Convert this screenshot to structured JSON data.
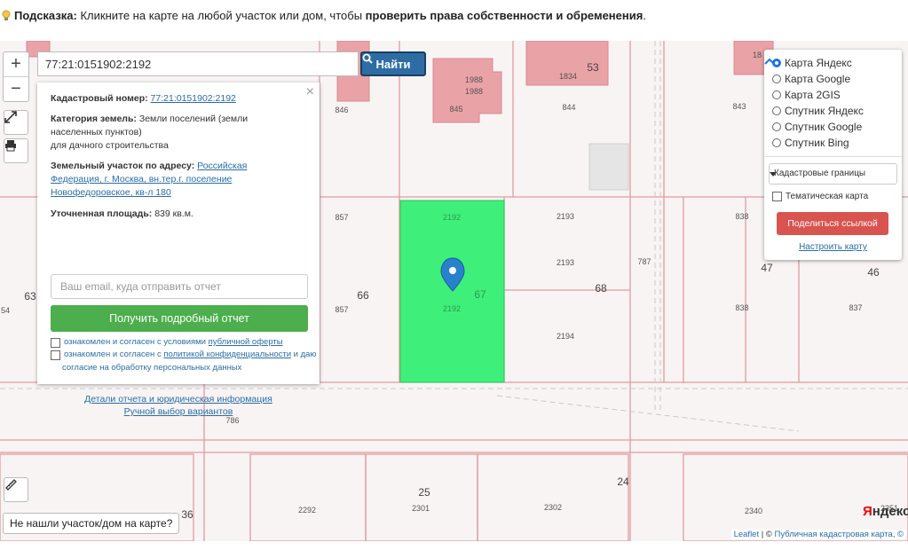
{
  "hint": {
    "label": "Подсказка:",
    "text": " Кликните на карте на любой участок или дом, чтобы ",
    "bold": "проверить права собственности и обременения",
    "end": "."
  },
  "search": {
    "value": "77:21:0151902:2192",
    "button_label": "Найти"
  },
  "zoom": {
    "in": "+",
    "out": "−"
  },
  "info": {
    "cad_label": "Кадастровый номер:",
    "cad_value": "77:21:0151902:2192",
    "cat_label": "Категория земель:",
    "cat_line1": "Земли поселений (земли",
    "cat_line2": "населенных пунктов)",
    "cat_line3": "для дачного строительства",
    "addr_label": "Земельный участок по адресу:",
    "addr_line1": "Российская",
    "addr_line2": "Федерация, г. Москва, вн.тер.г. поселение",
    "addr_line3": "Новофедоровское, кв-л 180",
    "area_label": "Уточненная площадь:",
    "area_value": "839 кв.м.",
    "email_placeholder": "Ваш email, куда отправить отчет",
    "report_button": "Получить подробный отчет",
    "agree1_prefix": "ознакомлен и согласен с условиями ",
    "agree1_link": "публичной оферты",
    "agree2_prefix": "ознакомлен и согласен с ",
    "agree2_link": "политикой конфиденциальности",
    "agree2_mid": " и даю",
    "agree2_line2": "согласие на обработку персональных данных",
    "details_link": "Детали отчета и юридическая информация",
    "manual_link": "Ручной выбор вариантов",
    "close": "×"
  },
  "layers": {
    "options": [
      "Карта Яндекс",
      "Карта Google",
      "Карта 2GIS",
      "Спутник Яндекс",
      "Спутник Google",
      "Спутник Bing"
    ],
    "selected": "Карта Яндекс",
    "overlay_select": "Кадастровые границы",
    "thematic": "Тематическая карта",
    "share_button": "Поделиться ссылкой",
    "configure_link": "Настроить карту"
  },
  "not_found": "Не нашли участок/дом на карте?",
  "attribution": {
    "leaflet": "Leaflet",
    "sep": " | © ",
    "source": "Публичная кадастровая карта, ©"
  },
  "yandex_logo": {
    "y": "Я",
    "rest": "ндекс"
  },
  "map_labels": {
    "b1988a": "1988",
    "b1988b": "1988",
    "b1834": "1834",
    "b53": "53",
    "b845": "845",
    "b844": "844",
    "b846": "846",
    "b843": "843",
    "b18": "18",
    "p857a": "857",
    "p857b": "857",
    "p66": "66",
    "p2192a": "2192",
    "p2192b": "2192",
    "p67": "67",
    "p2193a": "2193",
    "p2193b": "2193",
    "p68": "68",
    "p2194": "2194",
    "p787": "787",
    "p838a": "838",
    "p838b": "838",
    "p47": "47",
    "p46": "46",
    "p837": "837",
    "p63": "63",
    "p54": "54",
    "p786": "786",
    "p25": "25",
    "p2292": "2292",
    "p2301": "2301",
    "p2302": "2302",
    "p24": "24",
    "p2340": "2340",
    "p2351": "2351",
    "p36": "36"
  },
  "colors": {
    "selected_parcel": "#3ef07a",
    "building": "#e9a2a6",
    "boundary": "#e29aa0",
    "marker": "#2a81cb"
  }
}
